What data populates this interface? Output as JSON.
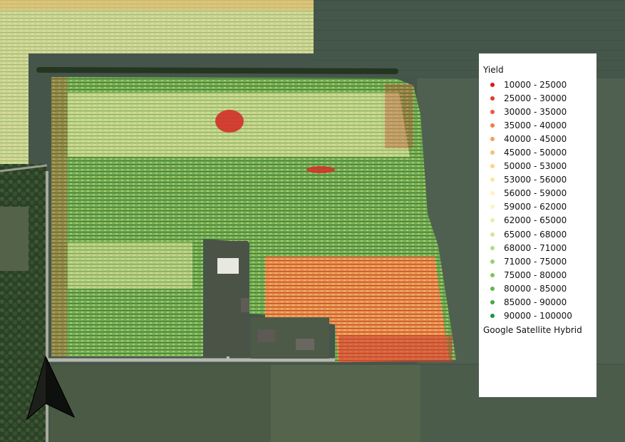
{
  "legend": {
    "title": "Yield",
    "classes": [
      {
        "label": "10000 - 25000",
        "color": "#d7191c"
      },
      {
        "label": "25000 - 30000",
        "color": "#de3b2b"
      },
      {
        "label": "30000 - 35000",
        "color": "#e55d3b"
      },
      {
        "label": "35000 - 40000",
        "color": "#ec7f4a"
      },
      {
        "label": "40000 - 45000",
        "color": "#f3a05a"
      },
      {
        "label": "45000 - 50000",
        "color": "#f9be72"
      },
      {
        "label": "50000 - 53000",
        "color": "#fdd48a"
      },
      {
        "label": "53000 - 56000",
        "color": "#fee5a2"
      },
      {
        "label": "56000 - 59000",
        "color": "#fff3ba"
      },
      {
        "label": "59000 - 62000",
        "color": "#f5f9bd"
      },
      {
        "label": "62000 - 65000",
        "color": "#e3f2a8"
      },
      {
        "label": "65000 - 68000",
        "color": "#cce893"
      },
      {
        "label": "68000 - 71000",
        "color": "#b4dd80"
      },
      {
        "label": "71000 - 75000",
        "color": "#9ad16e"
      },
      {
        "label": "75000 - 80000",
        "color": "#7fc45e"
      },
      {
        "label": "80000 - 85000",
        "color": "#62b650"
      },
      {
        "label": "85000 - 90000",
        "color": "#44a843"
      },
      {
        "label": "90000 - 100000",
        "color": "#1a9641"
      }
    ],
    "basemap_label": "Google Satellite Hybrid"
  },
  "north_arrow_icon": "north-arrow-icon"
}
